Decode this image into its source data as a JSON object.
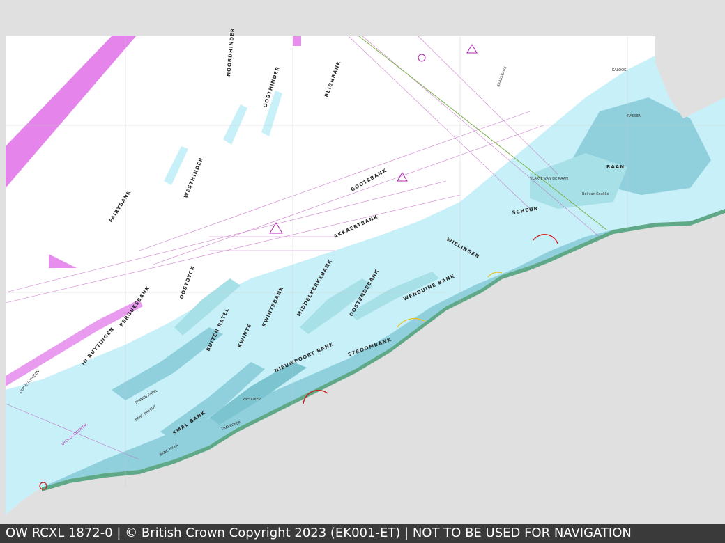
{
  "footer": {
    "text": "OW RCXL 1872-0 | © British Crown Copyright 2023 (EK001-ET) | NOT TO BE USED FOR NAVIGATION"
  },
  "map": {
    "colors": {
      "land": "#e0e0e0",
      "deep_water": "#ffffff",
      "shallow_water": "#c8f0f8",
      "very_shallow_water": "#8fd0dc",
      "drying_area": "#5fa888",
      "shoreline": "#3a7a5a",
      "restricted_area": "#e070e8",
      "routing_lines": "#c060c0",
      "warning_symbol": "#b020b0",
      "arc_red": "#d02020",
      "arc_yellow": "#e8c020"
    },
    "labels": {
      "fairybank": "FAIRYBANK",
      "westhinder": "WESTHINDER",
      "noordhinder": "NOORDHINDER",
      "oosthinder": "OOSTHINDER",
      "bligh_bank": "BLIGHBANK",
      "gootebank": "GOOTEBANK",
      "akkaertbank": "AKKAERTBANK",
      "oostdyck": "OOSTDYCK",
      "bergues_bank": "BERGUESBANK",
      "buiten_ratel": "BUITEN RATEL",
      "kwinte": "KWINTE",
      "kwintebank": "KWINTEBANK",
      "middelkerkebank": "MIDDELKERKEBANK",
      "oostendebank": "OOSTENDEBANK",
      "wenduine_bank": "WENDUINE BANK",
      "wielingen": "WIELINGEN",
      "scheur": "SCHEUR",
      "raan": "RAAN",
      "vlakte_van_de_raan": "VLAKTE VAN DE RAAN",
      "stroombank": "STROOMBANK",
      "nieuwpoort_bank": "NIEUWPOORT BANK",
      "smal_bank": "SMAL BANK",
      "banc_breedt": "BANC BREEDT",
      "binnen_ratel": "BINNEN RATEL",
      "in_ruytingen": "IN RUYTINGEN",
      "out_ruytingen": "OUT RUYTINGEN",
      "banc_hills": "BANC HILLS",
      "kalook": "KALOOK",
      "rassen": "RASSEN",
      "bol_van_knokke": "Bol van Knokke",
      "westdiep": "WESTDIEP",
      "trapegeer": "TRAPEGEER",
      "raabsbank": "RAABSBANK",
      "oostdyck_chan": "DYCK OCCIDENTAL"
    }
  }
}
